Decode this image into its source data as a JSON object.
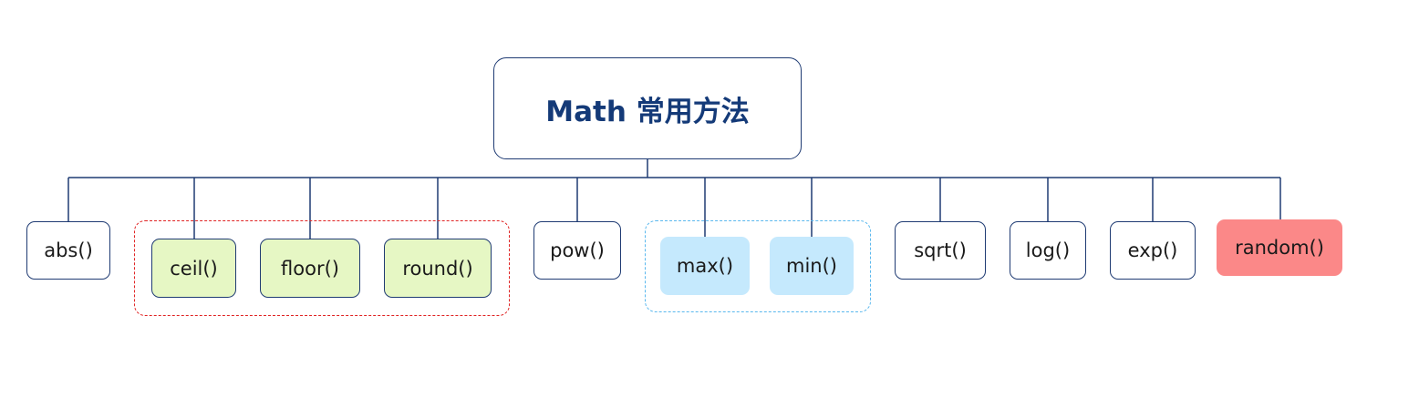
{
  "root": {
    "label": "Math 常用方法"
  },
  "methods": {
    "abs": "abs()",
    "ceil": "ceil()",
    "floor": "floor()",
    "round": "round()",
    "pow": "pow()",
    "max": "max()",
    "min": "min()",
    "sqrt": "sqrt()",
    "log": "log()",
    "exp": "exp()",
    "random": "random()"
  },
  "colors": {
    "line": "#1f3b73",
    "rounding_group_border": "#e02424",
    "rounding_fill": "#e6f7c4",
    "minmax_group_border": "#5ab8ee",
    "minmax_fill": "#c5e9fd",
    "random_fill": "#fb8888"
  }
}
